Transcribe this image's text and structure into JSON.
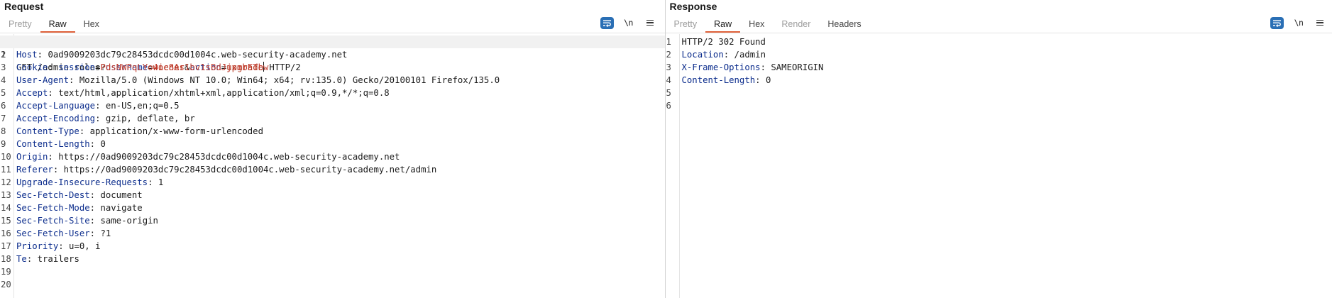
{
  "request": {
    "title": "Request",
    "tabs": [
      {
        "label": "Pretty",
        "state": "dim"
      },
      {
        "label": "Raw",
        "state": "active"
      },
      {
        "label": "Hex",
        "state": "normal"
      }
    ],
    "toolbar": {
      "wrap_icon": "wrap-lines-icon",
      "newline_label": "\\n",
      "menu_icon": "hamburger-menu-icon"
    },
    "line_numbers": [
      "1",
      "2",
      "3",
      "4",
      "5",
      "6",
      "7",
      "8",
      "9",
      "10",
      "11",
      "12",
      "13",
      "14",
      "15",
      "16",
      "17",
      "18",
      "19",
      "20"
    ],
    "request_line": {
      "method": "GET",
      "path": "/admin-roles?",
      "param1_name": "username",
      "eq1": "=",
      "param1_value": "wiener",
      "amp": "&",
      "param2_name": "action",
      "eq2": "=",
      "param2_value": "upgrade",
      "protocol": "HTTP/2"
    },
    "headers": [
      {
        "name": "Host",
        "value": "0ad9009203dc79c28453dcdc00d1004c.web-security-academy.net"
      },
      {
        "name": "Cookie",
        "value": "",
        "cookie_name": "session",
        "cookie_value": "PdsNWPqLYo4oc8As1bv1sBdJjxmbETbw"
      },
      {
        "name": "User-Agent",
        "value": "Mozilla/5.0 (Windows NT 10.0; Win64; x64; rv:135.0) Gecko/20100101 Firefox/135.0"
      },
      {
        "name": "Accept",
        "value": "text/html,application/xhtml+xml,application/xml;q=0.9,*/*;q=0.8"
      },
      {
        "name": "Accept-Language",
        "value": "en-US,en;q=0.5"
      },
      {
        "name": "Accept-Encoding",
        "value": "gzip, deflate, br"
      },
      {
        "name": "Content-Type",
        "value": "application/x-www-form-urlencoded"
      },
      {
        "name": "Content-Length",
        "value": "0"
      },
      {
        "name": "Origin",
        "value": "https://0ad9009203dc79c28453dcdc00d1004c.web-security-academy.net"
      },
      {
        "name": "Referer",
        "value": "https://0ad9009203dc79c28453dcdc00d1004c.web-security-academy.net/admin"
      },
      {
        "name": "Upgrade-Insecure-Requests",
        "value": "1"
      },
      {
        "name": "Sec-Fetch-Dest",
        "value": "document"
      },
      {
        "name": "Sec-Fetch-Mode",
        "value": "navigate"
      },
      {
        "name": "Sec-Fetch-Site",
        "value": "same-origin"
      },
      {
        "name": "Sec-Fetch-User",
        "value": "?1"
      },
      {
        "name": "Priority",
        "value": "u=0, i"
      },
      {
        "name": "Te",
        "value": "trailers"
      }
    ]
  },
  "response": {
    "title": "Response",
    "tabs": [
      {
        "label": "Pretty",
        "state": "dim"
      },
      {
        "label": "Raw",
        "state": "active"
      },
      {
        "label": "Hex",
        "state": "normal"
      },
      {
        "label": "Render",
        "state": "dim"
      },
      {
        "label": "Headers",
        "state": "normal"
      }
    ],
    "toolbar": {
      "wrap_icon": "wrap-lines-icon",
      "newline_label": "\\n",
      "menu_icon": "hamburger-menu-icon"
    },
    "line_numbers": [
      "1",
      "2",
      "3",
      "4",
      "5",
      "6"
    ],
    "status_line": "HTTP/2 302 Found",
    "headers": [
      {
        "name": "Location",
        "value": "/admin"
      },
      {
        "name": "X-Frame-Options",
        "value": "SAMEORIGIN"
      },
      {
        "name": "Content-Length",
        "value": "0"
      }
    ]
  },
  "colors": {
    "active_tab_underline": "#e0633c",
    "header_name": "#0b2c8c",
    "param_value": "#b5361f",
    "wrap_button": "#2a6fb5"
  }
}
